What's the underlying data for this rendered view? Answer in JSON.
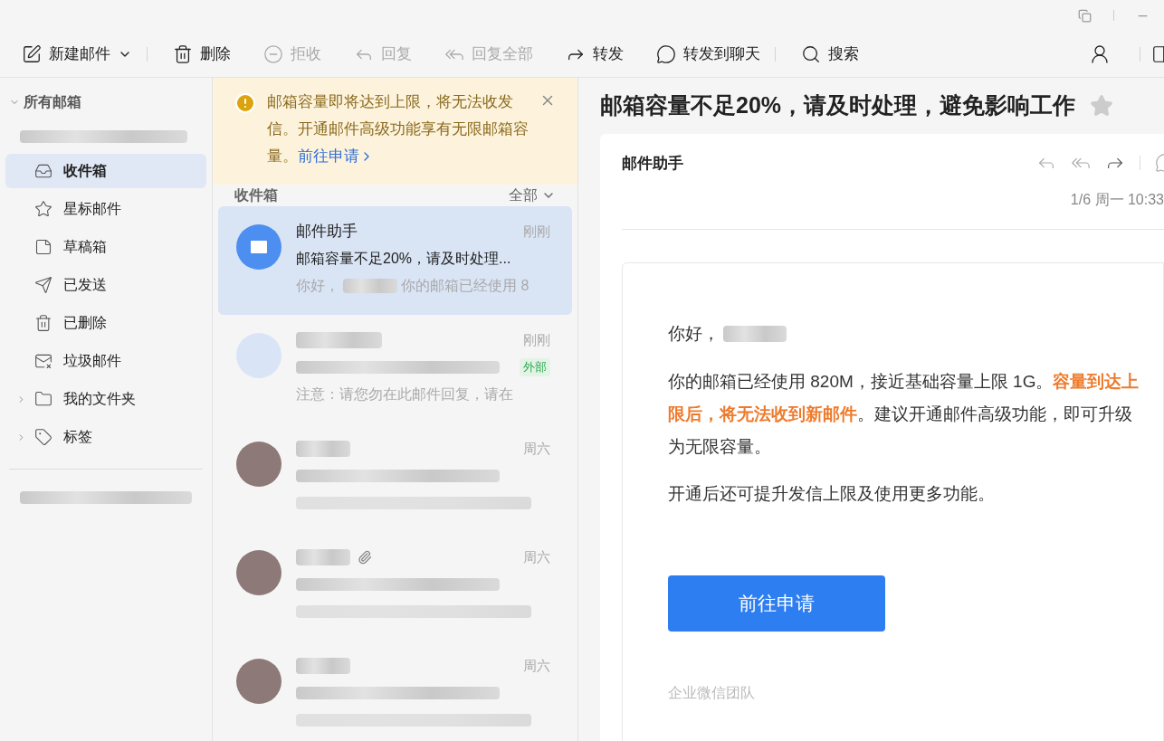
{
  "toolbar": [
    {
      "label": "新建邮件",
      "disabled": false,
      "caret": true,
      "divider_after": true
    },
    {
      "label": "删除",
      "disabled": false,
      "caret": false,
      "divider_after": false
    },
    {
      "label": "拒收",
      "disabled": true,
      "caret": false,
      "divider_after": false
    },
    {
      "label": "回复",
      "disabled": true,
      "caret": false,
      "divider_after": false
    },
    {
      "label": "回复全部",
      "disabled": true,
      "caret": false,
      "divider_after": false
    },
    {
      "label": "转发",
      "disabled": false,
      "caret": false,
      "divider_after": false
    },
    {
      "label": "转发到聊天",
      "disabled": false,
      "caret": false,
      "divider_after": true
    },
    {
      "label": "搜索",
      "disabled": false,
      "caret": false,
      "divider_after": false
    }
  ],
  "sidebar": {
    "header": {
      "label": "所有邮箱",
      "expanded": true
    },
    "folders": [
      {
        "label": "收件箱",
        "selected": true,
        "kind": "folder"
      },
      {
        "label": "星标邮件",
        "selected": false,
        "kind": "folder"
      },
      {
        "label": "草稿箱",
        "selected": false,
        "kind": "folder"
      },
      {
        "label": "已发送",
        "selected": false,
        "kind": "folder"
      },
      {
        "label": "已删除",
        "selected": false,
        "kind": "folder"
      },
      {
        "label": "垃圾邮件",
        "selected": false,
        "kind": "folder"
      },
      {
        "label": "我的文件夹",
        "selected": false,
        "kind": "group",
        "expanded": false
      },
      {
        "label": "标签",
        "selected": false,
        "kind": "group",
        "expanded": false
      }
    ]
  },
  "notice": {
    "text": "邮箱容量即将达到上限，将无法收发信。开通邮件高级功能享有无限邮箱容量。",
    "link": "前往申请"
  },
  "list": {
    "title": "收件箱",
    "filter": "全部",
    "messages": [
      {
        "sender": "邮件助手",
        "subject": "邮箱容量不足20%，请及时处理...",
        "preview_start": "你好，",
        "preview_end": "你的邮箱已经使用 8",
        "time": "刚刚",
        "selected": true,
        "kind": "system",
        "attachment": false
      },
      {
        "preview": "注意：请您勿在此邮件回复，请在",
        "time": "刚刚",
        "tag": "外部",
        "selected": false,
        "kind": "external",
        "attachment": false
      },
      {
        "time": "周六",
        "selected": false,
        "kind": "person",
        "attachment": false
      },
      {
        "time": "周六",
        "selected": false,
        "kind": "person",
        "attachment": true
      },
      {
        "time": "周六",
        "selected": false,
        "kind": "person",
        "attachment": false
      }
    ]
  },
  "reader": {
    "title": "邮箱容量不足20%，请及时处理，避免影响工作",
    "starred": false,
    "sender": "邮件助手",
    "date": "1/6 周一 10:33",
    "greeting": "你好，",
    "paragraphs": [
      "你的邮箱已经使用 820M，接近基础容量上限 1G。**容量到达上限后，将无法收到新邮件**。建议开通邮件高级功能，即可升级为无限容量。",
      "开通后还可提升发信上限及使用更多功能。"
    ],
    "button": "前往申请",
    "signature": "企业微信团队"
  }
}
